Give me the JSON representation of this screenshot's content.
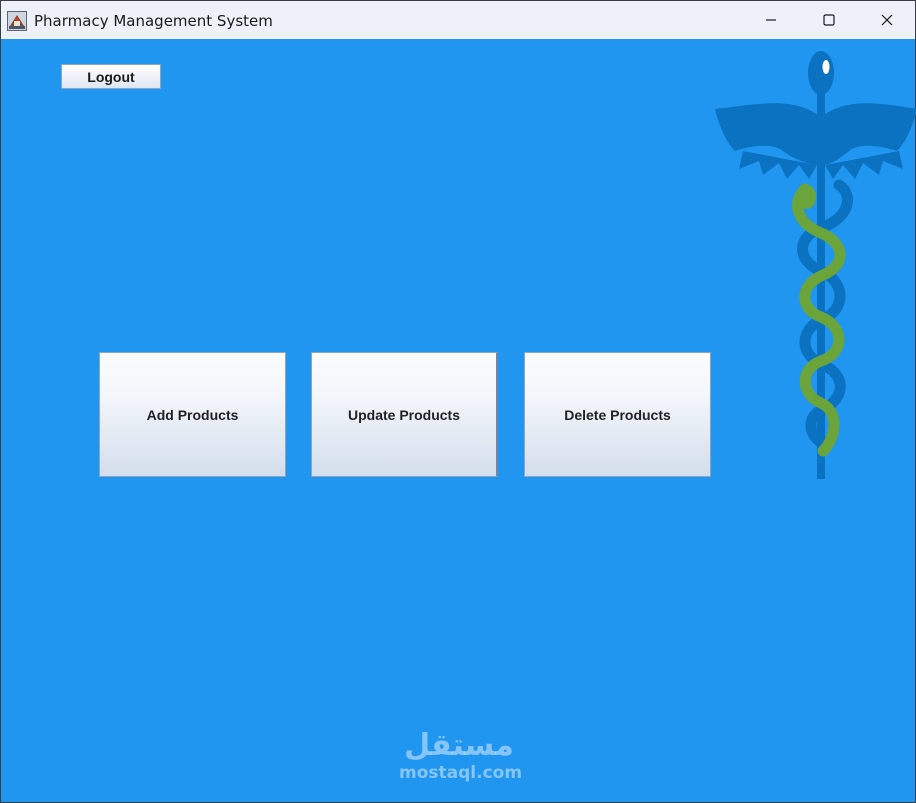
{
  "window": {
    "title": "Pharmacy Management System",
    "app_icon": "pharmacy-app-icon",
    "controls": {
      "minimize": "minimize-icon",
      "maximize": "maximize-icon",
      "close": "close-icon"
    }
  },
  "toolbar": {
    "logout_label": "Logout"
  },
  "actions": [
    {
      "label": "Add Products"
    },
    {
      "label": "Update Products"
    },
    {
      "label": "Delete Products"
    }
  ],
  "decoration": {
    "logo": "caduceus-icon"
  },
  "watermark": {
    "arabic": "مستقل",
    "latin": "mostaql.com"
  },
  "colors": {
    "background": "#2196f0",
    "titlebar": "#eef1f8",
    "logo_blue": "#0a72c0",
    "logo_green": "#6aa43a"
  }
}
